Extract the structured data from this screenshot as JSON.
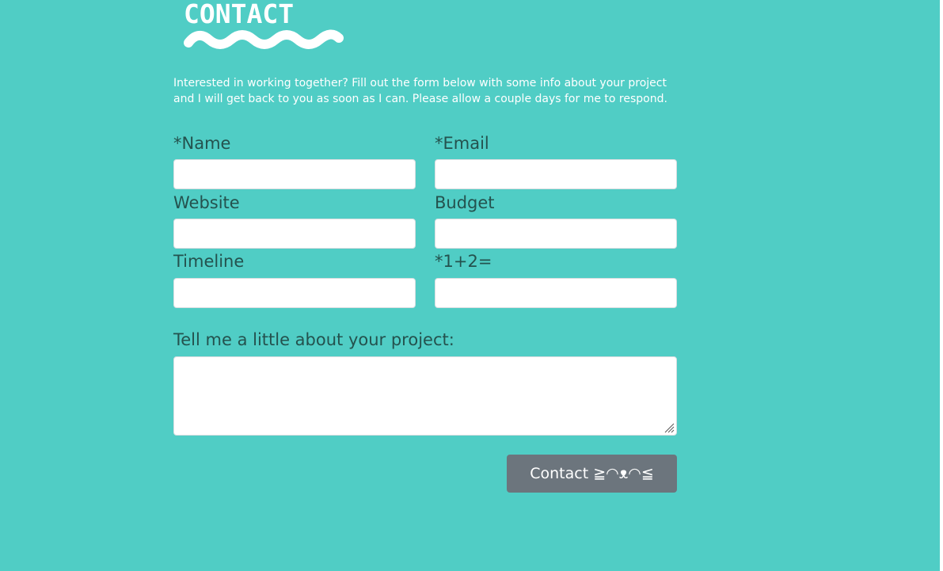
{
  "header": {
    "logo_text": "CONTACT"
  },
  "intro": {
    "line1": "Interested in working together? Fill out the form below with some info about your project",
    "line2": "and I will get back to you as soon as I can. Please allow a couple days for me to respond."
  },
  "form": {
    "name_label": "*Name",
    "email_label": "*Email",
    "website_label": "Website",
    "budget_label": "Budget",
    "timeline_label": "Timeline",
    "captcha_label": "*1+2=",
    "message_label": "Tell me a little about your project:",
    "name_value": "",
    "email_value": "",
    "website_value": "",
    "budget_value": "",
    "timeline_value": "",
    "captcha_value": "",
    "message_value": "",
    "submit_label": "Contact ≧◠ᴥ◠≦"
  },
  "colors": {
    "background": "#50cdc5",
    "label_text": "#24524e",
    "button_bg": "#6c757d",
    "white": "#ffffff"
  },
  "icons": {
    "logo_wave": "wave-decoration",
    "textarea_grip": "resize-grip-icon"
  }
}
